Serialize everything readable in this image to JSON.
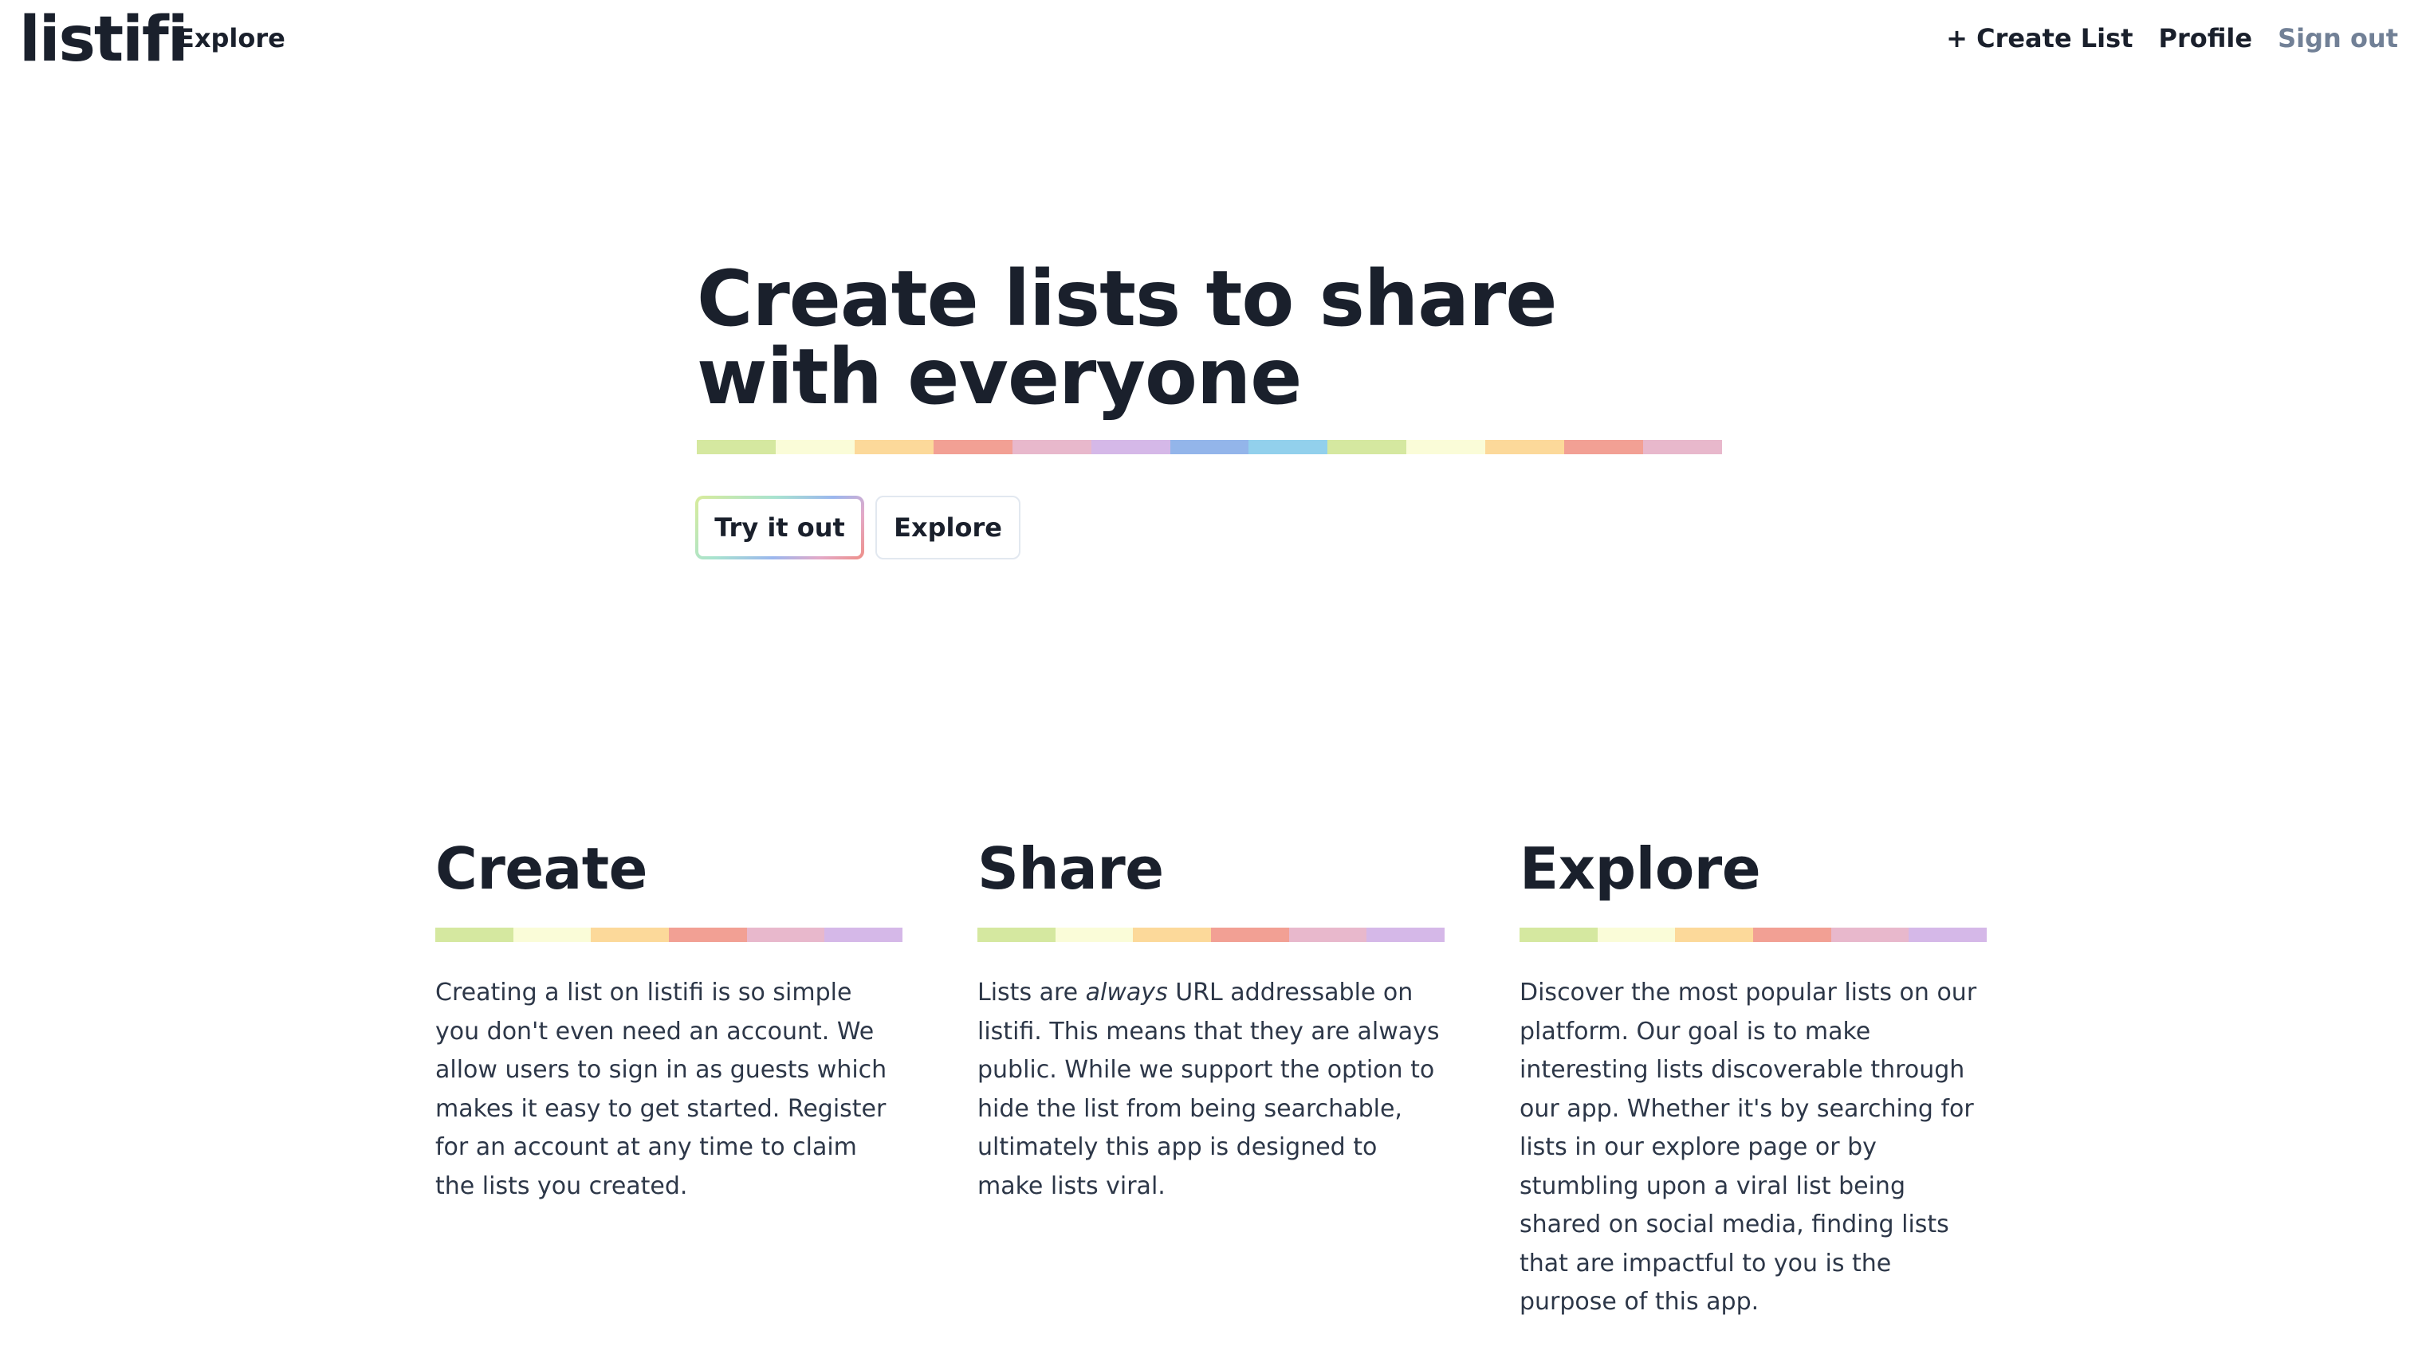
{
  "header": {
    "logo": "listifi",
    "nav_explore": "Explore",
    "create_list": "+ Create List",
    "profile": "Profile",
    "sign_out": "Sign out"
  },
  "hero": {
    "title": "Create lists to share with everyone",
    "try_button": "Try it out",
    "explore_button": "Explore"
  },
  "rainbow_colors": [
    "#d5e8a0",
    "#fafcd8",
    "#fcd99a",
    "#f2a094",
    "#e8b8cc",
    "#d5b8e8",
    "#93b5ea",
    "#92d0ec"
  ],
  "features": [
    {
      "title": "Create",
      "text": "Creating a list on listifi is so simple you don't even need an account. We allow users to sign in as guests which makes it easy to get started. Register for an account at any time to claim the lists you created."
    },
    {
      "title": "Share",
      "text_prefix": "Lists are ",
      "text_emphasis": "always",
      "text_suffix": " URL addressable on listifi. This means that they are always public. While we support the option to hide the list from being searchable, ultimately this app is designed to make lists viral."
    },
    {
      "title": "Explore",
      "text": "Discover the most popular lists on our platform. Our goal is to make interesting lists discoverable through our app. Whether it's by searching for lists in our explore page or by stumbling upon a viral list being shared on social media, finding lists that are impactful to you is the purpose of this app."
    }
  ]
}
